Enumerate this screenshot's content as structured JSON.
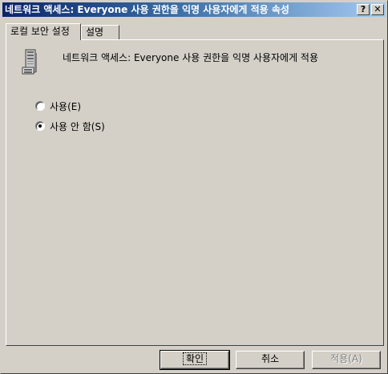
{
  "window": {
    "title": "네트워크 액세스: Everyone 사용 권한을 익명 사용자에게 적용 속성",
    "help_glyph": "?",
    "close_glyph": "✕"
  },
  "tabs": [
    {
      "label": "로컬 보안 설정",
      "active": true
    },
    {
      "label": "설명",
      "active": false
    }
  ],
  "panel": {
    "icon": "server-icon",
    "policy_name": "네트워크 액세스: Everyone 사용 권한을 익명 사용자에게 적용",
    "options": [
      {
        "label": "사용(E)",
        "checked": false
      },
      {
        "label": "사용 안 함(S)",
        "checked": true
      }
    ]
  },
  "buttons": {
    "ok": "확인",
    "cancel": "취소",
    "apply": "적용(A)"
  }
}
